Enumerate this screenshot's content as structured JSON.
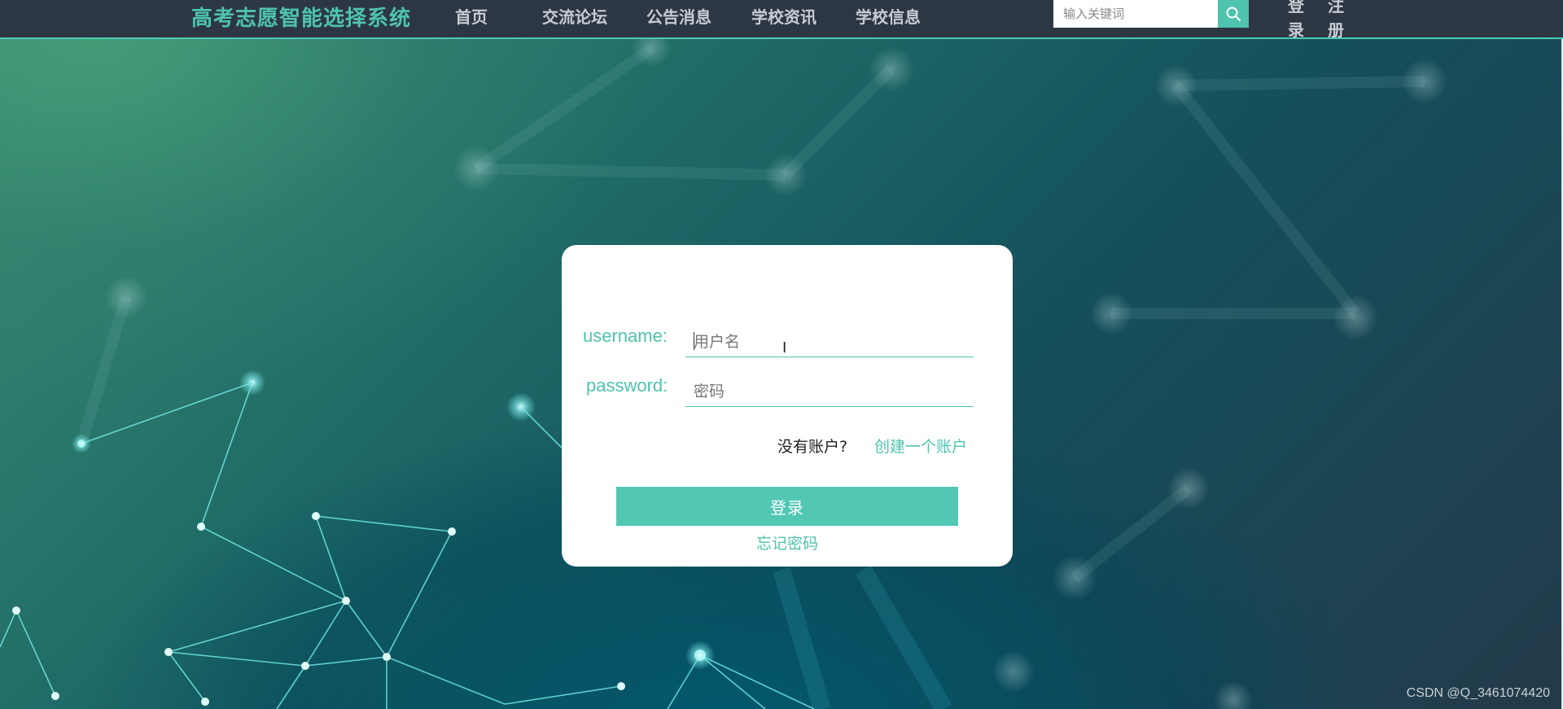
{
  "colors": {
    "accent": "#4ec3ad",
    "nav_bg": "#2d3744",
    "nav_text": "#c8ccd2",
    "card_bg": "#ffffff"
  },
  "header": {
    "brand": "高考志愿智能选择系统",
    "nav": [
      "首页",
      "交流论坛",
      "公告消息",
      "学校资讯",
      "学校信息"
    ],
    "search": {
      "placeholder": "输入关键词",
      "value": "",
      "icon": "search-icon"
    },
    "auth": {
      "login": "登录",
      "register": "注册"
    }
  },
  "login_form": {
    "username_label": "username:",
    "username_placeholder": "用户名",
    "username_value": "",
    "password_label": "password:",
    "password_placeholder": "密码",
    "password_value": "",
    "no_account_text": "没有账户?",
    "create_account_link": "创建一个账户",
    "submit_label": "登录",
    "forgot_password_link": "忘记密码"
  },
  "watermark": "CSDN @Q_3461074420"
}
